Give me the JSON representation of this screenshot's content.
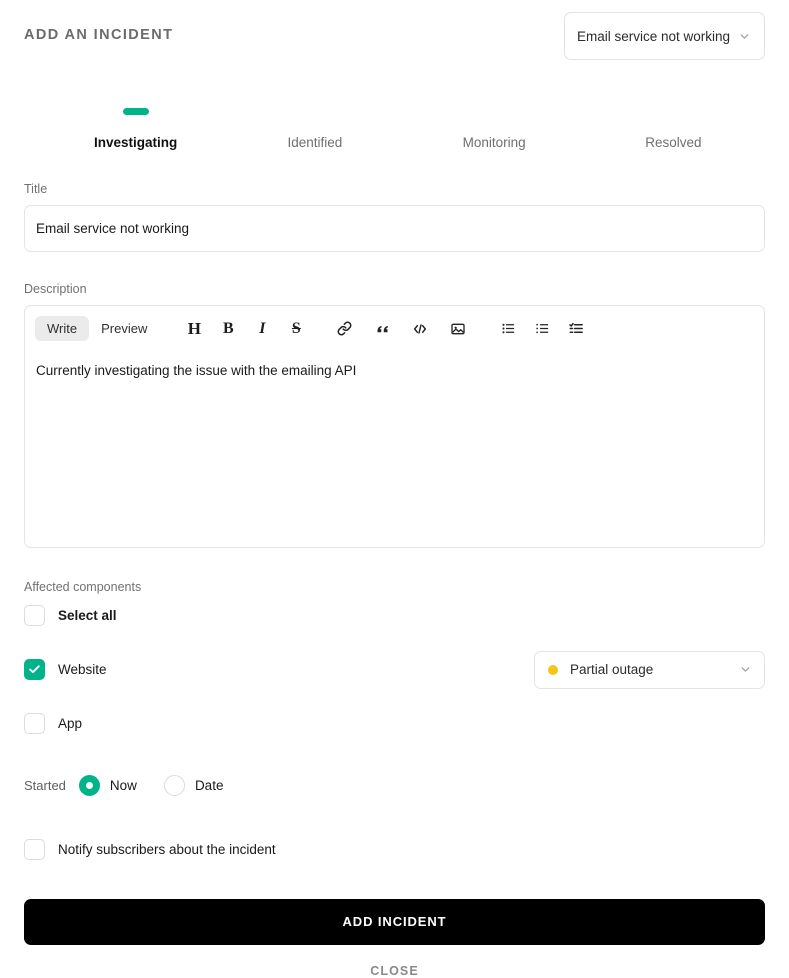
{
  "header": {
    "title": "ADD AN INCIDENT",
    "incident_select": {
      "value": "Email service not working",
      "icon": "chevron-down-icon"
    }
  },
  "steps": [
    {
      "label": "Investigating",
      "active": true
    },
    {
      "label": "Identified",
      "active": false
    },
    {
      "label": "Monitoring",
      "active": false
    },
    {
      "label": "Resolved",
      "active": false
    }
  ],
  "title_field": {
    "label": "Title",
    "value": "Email service not working"
  },
  "description_field": {
    "label": "Description",
    "tabs": [
      {
        "label": "Write",
        "active": true
      },
      {
        "label": "Preview",
        "active": false
      }
    ],
    "tools": [
      {
        "name": "heading-icon",
        "glyph": "H"
      },
      {
        "name": "bold-icon",
        "glyph": "B"
      },
      {
        "name": "italic-icon",
        "glyph": "I"
      },
      {
        "name": "strikethrough-icon",
        "glyph": "S"
      },
      {
        "name": "link-icon"
      },
      {
        "name": "quote-icon"
      },
      {
        "name": "code-icon"
      },
      {
        "name": "image-icon"
      },
      {
        "name": "bullet-list-icon"
      },
      {
        "name": "ordered-list-icon"
      },
      {
        "name": "task-list-icon"
      }
    ],
    "value": "Currently investigating the issue with the emailing API"
  },
  "components": {
    "label": "Affected components",
    "select_all": {
      "label": "Select all",
      "checked": false
    },
    "items": [
      {
        "label": "Website",
        "checked": true,
        "status": {
          "label": "Partial outage",
          "color": "#F5C518"
        }
      },
      {
        "label": "App",
        "checked": false,
        "status": null
      }
    ]
  },
  "started": {
    "label": "Started",
    "options": [
      {
        "label": "Now",
        "selected": true
      },
      {
        "label": "Date",
        "selected": false
      }
    ]
  },
  "notify": {
    "label": "Notify subscribers about the incident",
    "checked": false
  },
  "footer": {
    "submit_label": "ADD INCIDENT",
    "close_label": "CLOSE"
  },
  "colors": {
    "accent": "#00b389",
    "submit_bg": "#000000",
    "status_partial": "#F5C518"
  }
}
